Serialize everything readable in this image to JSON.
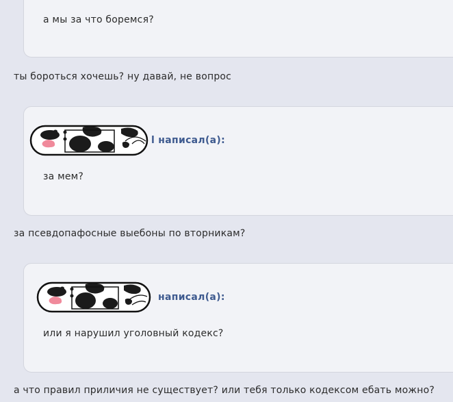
{
  "posts": [
    {
      "quote": {
        "author_suffix": "",
        "text": "а мы за что боремся?"
      },
      "reply": "ты бороться хочешь? ну давай, не вопрос"
    },
    {
      "quote": {
        "author_suffix": "l написал(а):",
        "text": "за мем?"
      },
      "reply": "за псевдопафосные выебоны по вторникам?"
    },
    {
      "quote": {
        "author_suffix": "написал(а):",
        "text": "или я нарушил уголовный кодекс?"
      },
      "reply": "а что правил приличия не существует? или тебя только кодексом ебать можно?"
    }
  ],
  "icons": {
    "author_avatar": "cow-print-badge-icon"
  },
  "colors": {
    "background": "#e4e6ef",
    "quote_bg": "#f2f3f7",
    "author": "#3e5a8f"
  }
}
